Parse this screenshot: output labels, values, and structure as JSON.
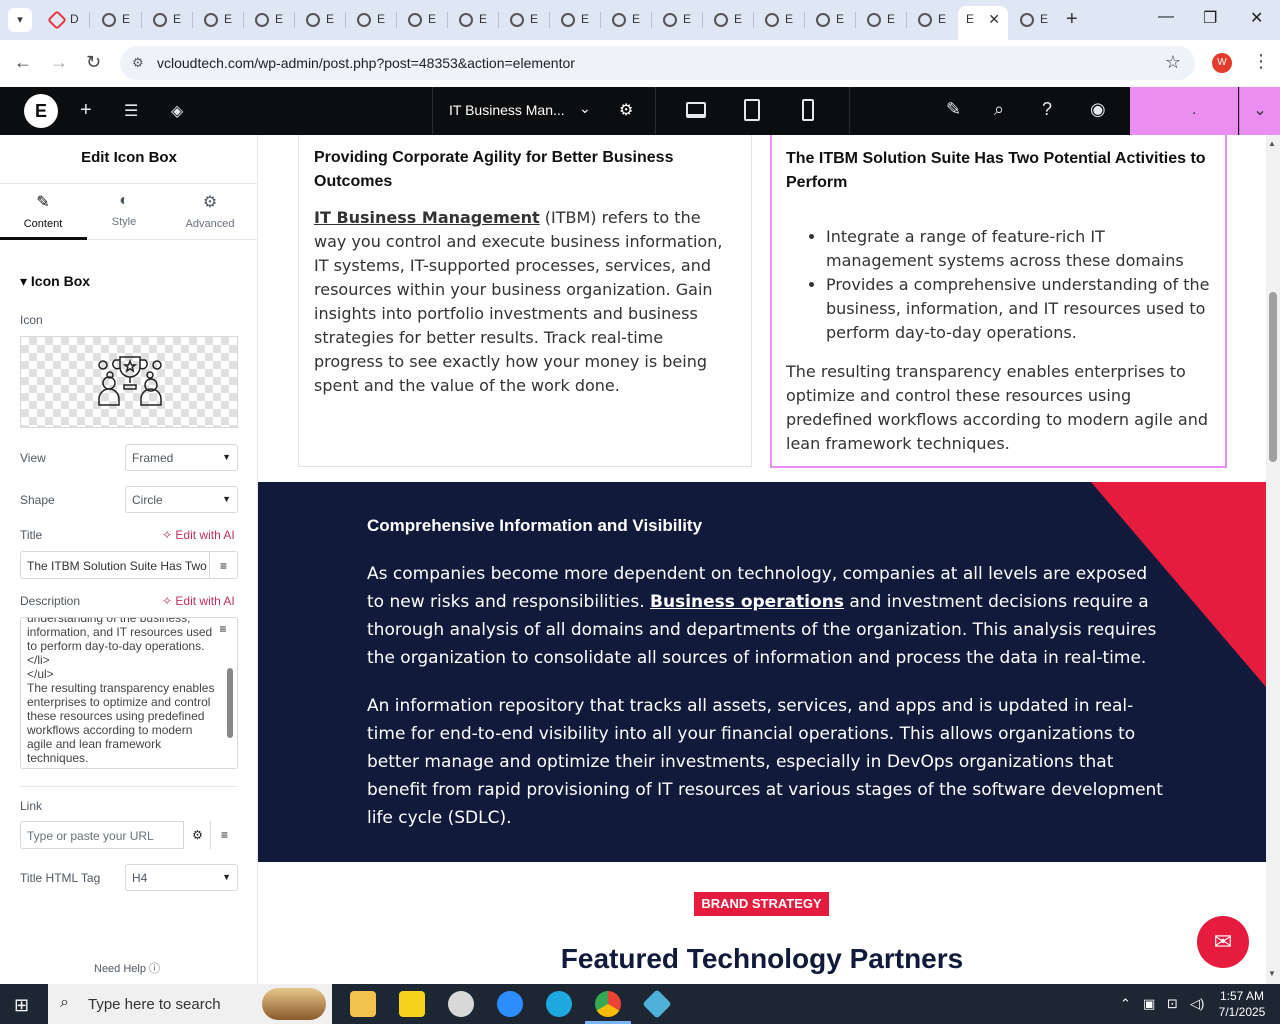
{
  "browser": {
    "active_tab_title": "E",
    "other_tab_title": "E",
    "first_tab_title": "D",
    "url": "vcloudtech.com/wp-admin/post.php?post=48353&action=elementor",
    "profile_initial": "W"
  },
  "elementor": {
    "doc_name": "IT Business Man...",
    "publish_label": "."
  },
  "panel": {
    "title": "Edit Icon Box",
    "tabs": [
      {
        "label": "Content"
      },
      {
        "label": "Style"
      },
      {
        "label": "Advanced"
      }
    ],
    "section": "Icon Box",
    "icon_label": "Icon",
    "view_label": "View",
    "view_value": "Framed",
    "shape_label": "Shape",
    "shape_value": "Circle",
    "title_label": "Title",
    "edit_ai": "Edit with AI",
    "title_value": "The ITBM Solution Suite Has Two",
    "description_label": "Description",
    "description_text": "understanding of the business, information, and IT resources used to perform day-to-day operations.\n</li>\n</ul>\nThe resulting transparency enables enterprises to optimize and control these resources using predefined workflows according to modern agile and lean framework techniques.",
    "link_label": "Link",
    "link_placeholder": "Type or paste your URL",
    "title_tag_label": "Title HTML Tag",
    "title_tag_value": "H4",
    "need_help": "Need Help"
  },
  "canvas": {
    "card1": {
      "title": "Providing Corporate Agility for Better Business Outcomes",
      "link_text": "IT Business Management",
      "body": " (ITBM) refers to the way you control and execute business information, IT systems, IT-supported processes, services, and resources within your business organization. Gain insights into portfolio investments and business strategies for better results. Track real-time progress to see exactly how your money is being spent and the value of the work done."
    },
    "card2": {
      "title": "The ITBM Solution Suite Has Two Potential Activities to Perform",
      "bullets": [
        "Integrate a range of feature-rich IT management systems across these domains",
        "Provides a comprehensive understanding of the business, information, and IT resources used to perform day-to-day operations."
      ],
      "body": "The resulting transparency enables enterprises to optimize and control these resources using predefined workflows according to modern agile and lean framework techniques."
    },
    "dark": {
      "title": "Comprehensive Information and Visibility",
      "p1_before": "As companies become more dependent on technology, companies at all levels are exposed to new risks and responsibilities. ",
      "p1_link": "Business operations",
      "p1_after": " and investment decisions require a thorough analysis of all domains and departments of the organization. This analysis requires the organization to consolidate all sources of information and process the data in real-time.",
      "p2": "An information repository that tracks all assets, services, and apps and is updated in real-time for end-to-end visibility into all your financial operations. This allows organizations to better manage and optimize their investments, especially in DevOps organizations that benefit from rapid provisioning of IT resources at various stages of the software development life cycle (SDLC)."
    },
    "badge": "BRAND STRATEGY",
    "featured": "Featured Technology Partners"
  },
  "taskbar": {
    "search_placeholder": "Type here to search",
    "time": "1:57 AM",
    "date": "7/1/2025"
  }
}
